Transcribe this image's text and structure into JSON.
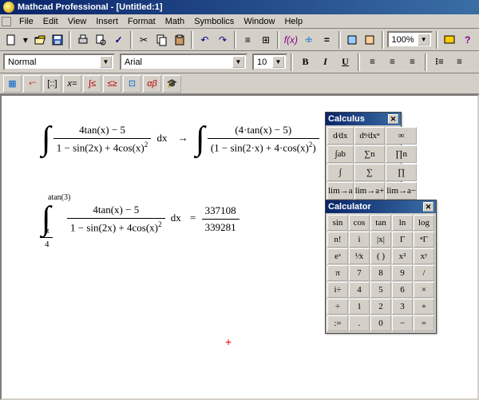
{
  "title": "Mathcad Professional - [Untitled:1]",
  "menu": [
    "File",
    "Edit",
    "View",
    "Insert",
    "Format",
    "Math",
    "Symbolics",
    "Window",
    "Help"
  ],
  "zoom": "100%",
  "style_combo": "Normal",
  "font_combo": "Arial",
  "size_combo": "10",
  "fx_label": "f(x)",
  "bold": "B",
  "italic": "I",
  "underline": "U",
  "math1": {
    "num": "4tan(x) − 5",
    "den_a": "1 − sin(2x) + 4cos(x)",
    "den_exp": "2",
    "dx": "dx",
    "arrow": "→",
    "num2": "(4·tan(x) − 5)",
    "den2_a": "1 − sin(2·x) + 4·cos(x)",
    "den2_exp": "2"
  },
  "math2": {
    "upper": "atan(3)",
    "lower_num": "π",
    "lower_den": "4",
    "num": "4tan(x) − 5",
    "den_a": "1 − sin(2x) + 4cos(x)",
    "den_exp": "2",
    "dx": "dx",
    "eq": "=",
    "res_num": "337108",
    "res_den": "339281"
  },
  "calculus": {
    "title": "Calculus",
    "cells": [
      "d⁄dx",
      "dⁿ⁄dxⁿ",
      "∞",
      "∫ab",
      "∑n",
      "∏n",
      "∫",
      "∑",
      "∏",
      "lim→a",
      "lim→a+",
      "lim→a−"
    ]
  },
  "calculator": {
    "title": "Calculator",
    "cells": [
      "sin",
      "cos",
      "tan",
      "ln",
      "log",
      "n!",
      "i",
      "|x|",
      "Γ",
      "ⁿΓ",
      "eˣ",
      "¹⁄x",
      "( )",
      "x²",
      "xʸ",
      "π",
      "7",
      "8",
      "9",
      "/",
      "i÷",
      "4",
      "5",
      "6",
      "×",
      "÷",
      "1",
      "2",
      "3",
      "+",
      ":=",
      ".",
      "0",
      "−",
      "="
    ]
  }
}
